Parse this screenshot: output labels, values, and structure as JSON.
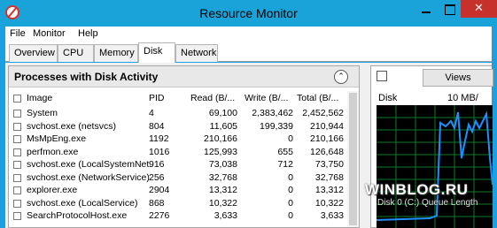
{
  "window": {
    "title": "Resource Monitor",
    "close_glyph": "✕"
  },
  "menu": [
    "File",
    "Monitor",
    "Help"
  ],
  "tabs": [
    "Overview",
    "CPU",
    "Memory",
    "Disk",
    "Network"
  ],
  "active_tab": "Disk",
  "panel": {
    "title": "Processes with Disk Activity",
    "collapse_glyph": "⌃",
    "columns": [
      "Image",
      "PID",
      "Read (B/...",
      "Write (B/...",
      "Total (B/..."
    ],
    "rows": [
      {
        "image": "System",
        "pid": "4",
        "read": "69,100",
        "write": "2,383,462",
        "total": "2,452,562"
      },
      {
        "image": "svchost.exe (netsvcs)",
        "pid": "804",
        "read": "11,605",
        "write": "199,339",
        "total": "210,944"
      },
      {
        "image": "MsMpEng.exe",
        "pid": "1192",
        "read": "210,166",
        "write": "0",
        "total": "210,166"
      },
      {
        "image": "perfmon.exe",
        "pid": "1016",
        "read": "125,993",
        "write": "655",
        "total": "126,648"
      },
      {
        "image": "svchost.exe (LocalSystemNet...",
        "pid": "916",
        "read": "73,038",
        "write": "712",
        "total": "73,750"
      },
      {
        "image": "svchost.exe (NetworkService)",
        "pid": "256",
        "read": "32,768",
        "write": "0",
        "total": "32,768"
      },
      {
        "image": "explorer.exe",
        "pid": "2904",
        "read": "13,312",
        "write": "0",
        "total": "13,312"
      },
      {
        "image": "svchost.exe (LocalService)",
        "pid": "868",
        "read": "10,322",
        "write": "0",
        "total": "10,322"
      },
      {
        "image": "SearchProtocolHost.exe",
        "pid": "2276",
        "read": "3,633",
        "write": "0",
        "total": "3,633"
      }
    ]
  },
  "right": {
    "views_label": "Views",
    "disk_label": "Disk",
    "disk_scale": "10 MB/",
    "graph_caption": "Disk 0 (C:) Queue Length",
    "watermark": "WINBLOG.RU"
  },
  "colors": {
    "title_bar": "#1aa3d9",
    "close_button": "#c7312b",
    "graph_line": "#1e8fff",
    "graph_grid": "#0b7a2a"
  }
}
